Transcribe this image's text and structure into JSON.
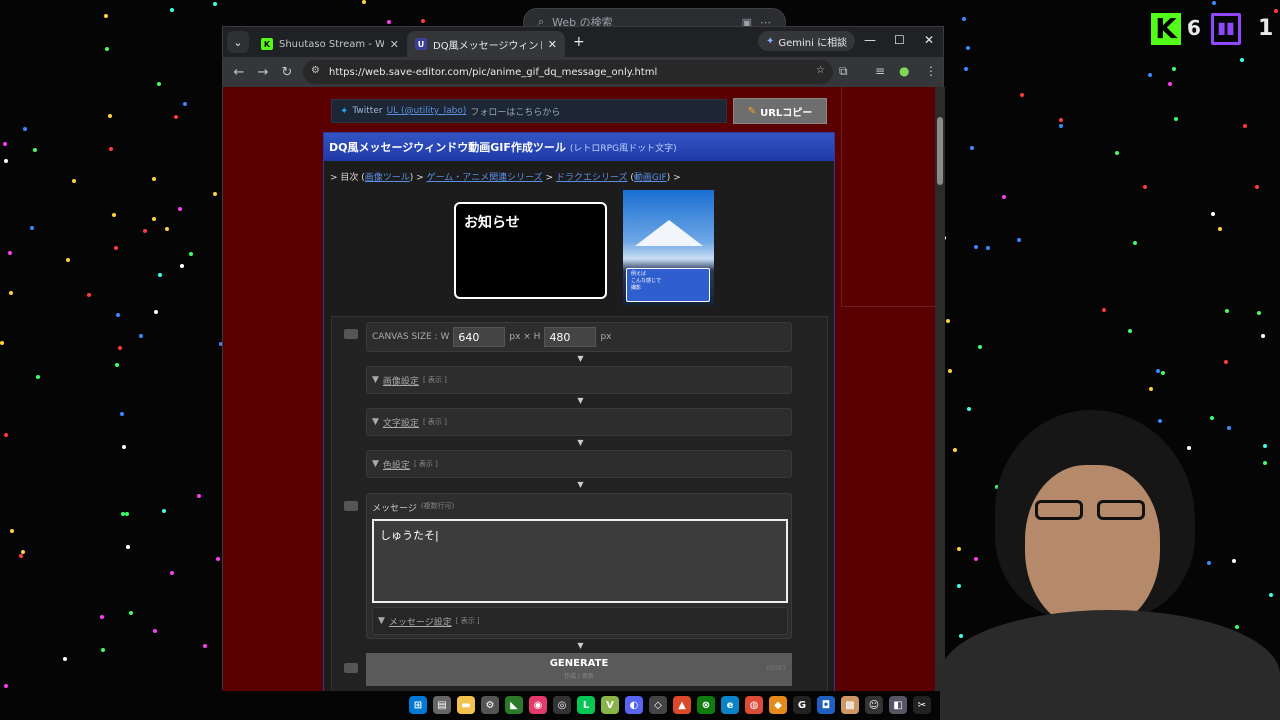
{
  "websearch": {
    "placeholder": "Web の検索"
  },
  "tabs": [
    {
      "title": "Shuutaso Stream - Watch Live ..."
    },
    {
      "title": "DQ風メッセージウィンドウ動画GIF作..."
    }
  ],
  "gemini_label": "Gemini に相談",
  "url": "https://web.save-editor.com/pic/anime_gif_dq_message_only.html",
  "twitter": {
    "label": "Twitter",
    "handle": "UL (@utility_labo)",
    "follow": "フォローはこちらから"
  },
  "urlcopy_label": "URLコピー",
  "panel": {
    "title": "DQ風メッセージウィンドウ動画GIF作成ツール",
    "subtitle": "(レトロRPG風ドット文字)"
  },
  "breadcrumb": {
    "prefix": "> 目次 (",
    "l1": "画像ツール",
    "s1": ") > ",
    "l2": "ゲーム・アニメ関連シリーズ",
    "s2": " > ",
    "l3": "ドラクエシリーズ",
    "s3": " (",
    "l4": "動画GIF",
    "s4": ") >"
  },
  "preview_text": "お知らせ",
  "thumb_text": [
    "例えば",
    "こんな感じで",
    "撮影"
  ],
  "canvas": {
    "label": "CANVAS SIZE : W",
    "w": "640",
    "w_unit": "px × H",
    "h": "480",
    "h_unit": "px"
  },
  "sections": [
    {
      "label": "画像設定",
      "toggle": "[ 表示 ]"
    },
    {
      "label": "文字設定",
      "toggle": "[ 表示 ]"
    },
    {
      "label": "色設定",
      "toggle": "[ 表示 ]"
    }
  ],
  "message": {
    "label": "メッセージ",
    "hint": "(複数行可)",
    "value": "しゅうたそ"
  },
  "message_settings": {
    "label": "メッセージ設定",
    "toggle": "[ 表示 ]"
  },
  "generate": {
    "label": "GENERATE",
    "hint": "作成 / 更新",
    "reset": "RESET"
  },
  "arrow": "▼",
  "overlay": {
    "kick_count": "6",
    "twitch_count": "1"
  },
  "colors": {
    "page_bg": "#5a0000",
    "panel_head": "#2948b8",
    "link": "#5b8fe6",
    "kick": "#53fc18",
    "twitch": "#9146ff"
  }
}
